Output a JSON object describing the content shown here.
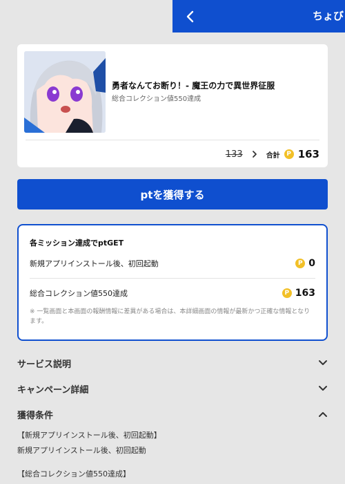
{
  "header": {
    "title": "ちょびリッチ",
    "back_icon": "chevron-left-icon",
    "background": "#0f4fcf"
  },
  "app": {
    "title": "勇者なんてお断り！- 魔王の力で異世界征服",
    "subtitle": "総合コレクション値550達成",
    "old_points": "133",
    "arrow": "›",
    "total_label": "合計",
    "coin_letter": "P",
    "total_points": "163"
  },
  "cta": {
    "label": "ptを獲得する"
  },
  "missions": {
    "heading": "各ミッション達成でptGET",
    "items": [
      {
        "label": "新規アプリインストール後、初回起動",
        "points": "0"
      },
      {
        "label": "総合コレクション値550達成",
        "points": "163"
      }
    ],
    "note": "※ 一覧画面と本画面の報酬情報に差異がある場合は、本詳細画面の情報が最新かつ正確な情報となります。"
  },
  "sections": [
    {
      "title": "サービス説明",
      "state": "collapsed"
    },
    {
      "title": "キャンペーン詳細",
      "state": "collapsed"
    },
    {
      "title": "獲得条件",
      "state": "expanded"
    }
  ],
  "conditions": {
    "line1": "【新規アプリインストール後、初回起動】",
    "line2": "新規アプリインストール後、初回起動",
    "line3": "【総合コレクション値550達成】"
  },
  "colors": {
    "accent": "#0f4fcf",
    "coin": "#f2c027",
    "background": "#e6e6e6"
  }
}
